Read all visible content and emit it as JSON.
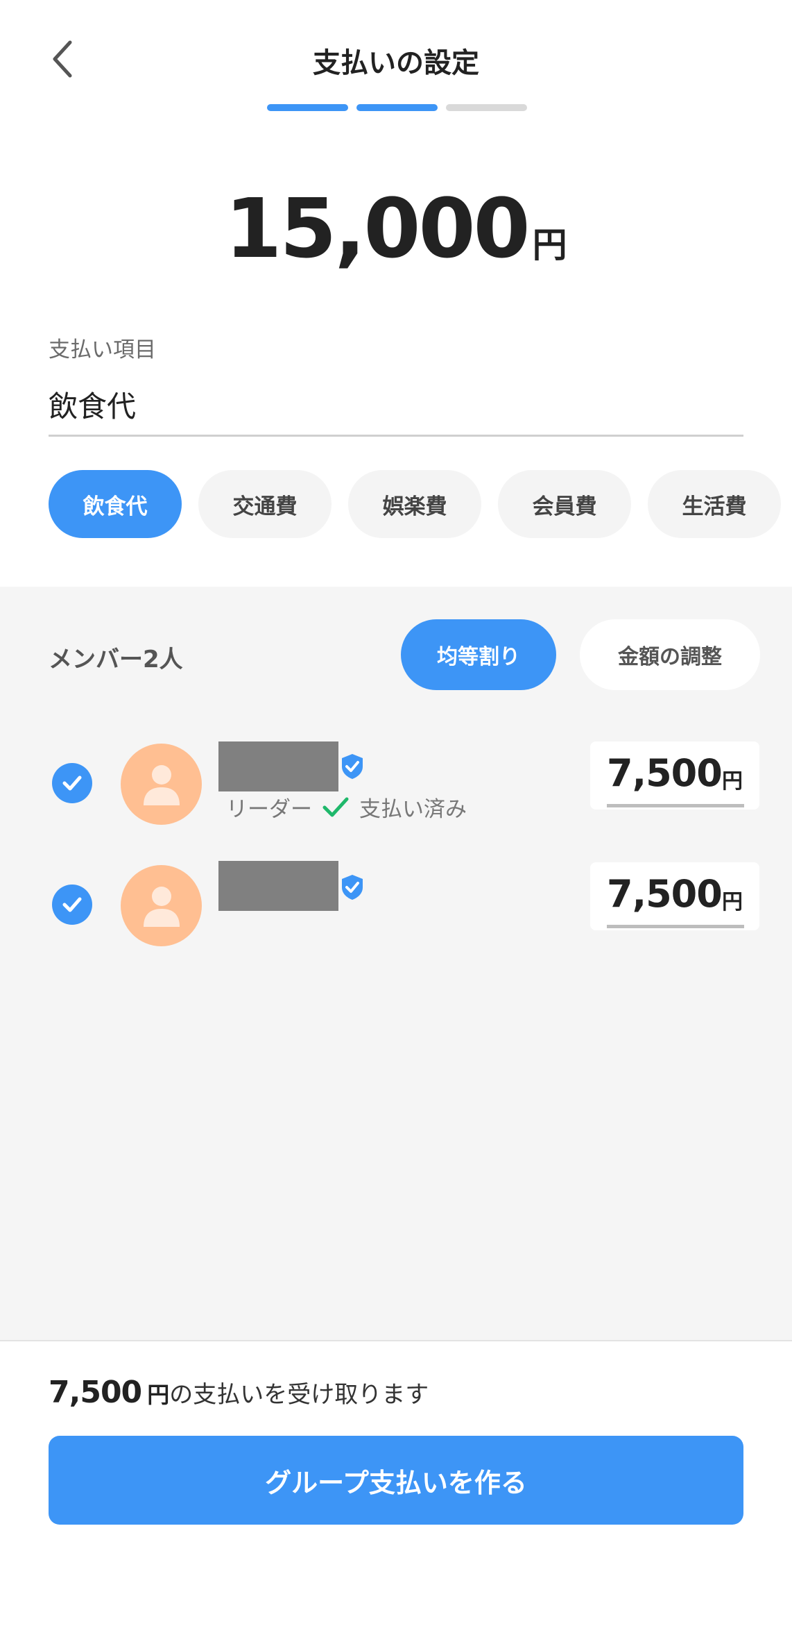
{
  "header": {
    "title": "支払いの設定",
    "steps_total": 3,
    "steps_done": 2
  },
  "amount": {
    "value": "15,000",
    "unit": "円"
  },
  "item": {
    "label": "支払い項目",
    "value": "飲食代"
  },
  "categories": [
    {
      "label": "飲食代",
      "selected": true
    },
    {
      "label": "交通費",
      "selected": false
    },
    {
      "label": "娯楽費",
      "selected": false
    },
    {
      "label": "会員費",
      "selected": false
    },
    {
      "label": "生活費",
      "selected": false
    }
  ],
  "members": {
    "title": "メンバー2人",
    "split_equal_label": "均等割り",
    "split_adjust_label": "金額の調整",
    "list": [
      {
        "role": "リーダー",
        "status": "支払い済み",
        "amount": "7,500",
        "unit": "円",
        "checked": true
      },
      {
        "role": "",
        "status": "",
        "amount": "7,500",
        "unit": "円",
        "checked": true
      }
    ]
  },
  "footer": {
    "receive_amount": "7,500",
    "receive_unit": "円",
    "receive_text": "の支払いを受け取ります",
    "cta_label": "グループ支払いを作る"
  },
  "colors": {
    "accent": "#3d95f6",
    "avatar": "#ffbf92",
    "paid_check": "#1fb86b"
  },
  "icons": [
    "back-arrow-icon",
    "checkbox-checked-icon",
    "user-avatar-icon",
    "verified-shield-icon",
    "paid-check-icon"
  ]
}
